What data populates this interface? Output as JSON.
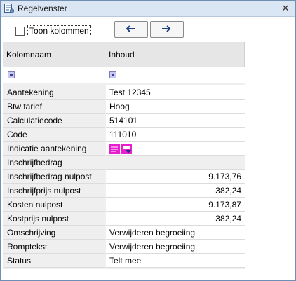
{
  "window": {
    "title": "Regelvenster",
    "close_glyph": "✕"
  },
  "toolbar": {
    "show_columns_label": "Toon kolommen",
    "show_columns_checked": false,
    "prev_icon": "arrow-left-icon",
    "next_icon": "arrow-right-icon"
  },
  "grid": {
    "headers": {
      "name": "Kolomnaam",
      "value": "Inhoud"
    },
    "rows": [
      {
        "name": "Aantekening",
        "value": "Test 12345",
        "align": "left"
      },
      {
        "name": "Btw tarief",
        "value": "Hoog",
        "align": "left"
      },
      {
        "name": "Calculatiecode",
        "value": "514101",
        "align": "left"
      },
      {
        "name": "Code",
        "value": "111010",
        "align": "left"
      },
      {
        "name": "Indicatie aantekening",
        "value": "",
        "align": "icons"
      },
      {
        "name": "Inschrijfbedrag",
        "value": "",
        "align": "empty"
      },
      {
        "name": "Inschrijfbedrag nulpost",
        "value": "9.173,76",
        "align": "right"
      },
      {
        "name": "Inschrijfprijs nulpost",
        "value": "382,24",
        "align": "right"
      },
      {
        "name": "Kosten nulpost",
        "value": "9.173,87",
        "align": "right"
      },
      {
        "name": "Kostprijs nulpost",
        "value": "382,24",
        "align": "right"
      },
      {
        "name": "Omschrijving",
        "value": "Verwijderen begroeiing",
        "align": "left"
      },
      {
        "name": "Romptekst",
        "value": "Verwijderen begroeiing",
        "align": "left"
      },
      {
        "name": "Status",
        "value": "Telt mee",
        "align": "left"
      }
    ]
  },
  "colors": {
    "title_bar": "#dbe6f4",
    "header_bg": "#e6e6e6",
    "icon_magenta": "#e81fcf",
    "filter_icon": "#3b3b9a"
  }
}
